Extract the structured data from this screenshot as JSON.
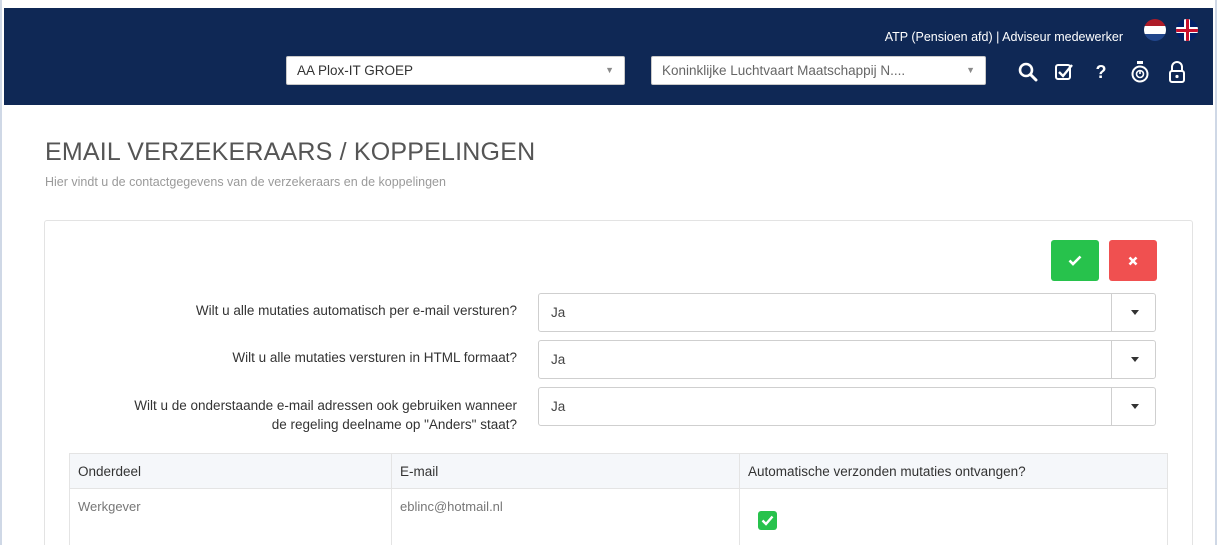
{
  "header": {
    "user_line": "ATP (Pensioen afd) | Adviseur medewerker",
    "org_select": "AA Plox-IT GROEP",
    "company_select": "Koninklijke Luchtvaart Maatschappij N....",
    "icons": [
      "search-icon",
      "checklist-icon",
      "help-icon",
      "timer-icon",
      "lock-icon"
    ],
    "languages": [
      "nl-flag",
      "uk-flag"
    ],
    "colors": {
      "background": "#0f2855"
    }
  },
  "page": {
    "title": "EMAIL VERZEKERAARS / KOPPELINGEN",
    "subtitle": "Hier vindt u de contactgegevens van de verzekeraars en de koppelingen"
  },
  "actions": {
    "colors": {
      "confirm": "#27c24c",
      "cancel": "#f05050"
    }
  },
  "questions": [
    {
      "label": "Wilt u alle mutaties automatisch per e-mail versturen?",
      "value": "Ja"
    },
    {
      "label": "Wilt u alle mutaties versturen in HTML formaat?",
      "value": "Ja"
    },
    {
      "label_line1": "Wilt u de onderstaande e-mail adressen ook gebruiken wanneer",
      "label_line2": "de regeling deelname op \"Anders\" staat?",
      "value": "Ja"
    }
  ],
  "table": {
    "headers": [
      "Onderdeel",
      "E-mail",
      "Automatische verzonden mutaties ontvangen?"
    ],
    "rows": [
      {
        "onderdeel": "Werkgever",
        "email": "eblinc@hotmail.nl",
        "checked": true
      }
    ]
  }
}
